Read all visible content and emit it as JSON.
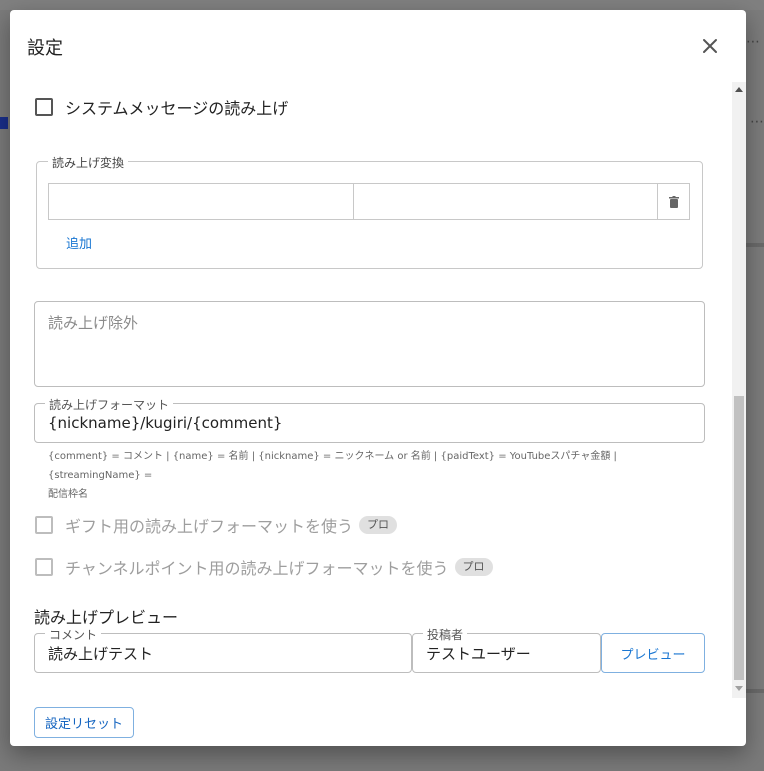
{
  "dialog": {
    "title": "設定"
  },
  "tts": {
    "system_message_label": "システムメッセージの読み上げ",
    "conversion": {
      "legend": "読み上げ変換",
      "from_value": "",
      "to_value": "",
      "add_label": "追加"
    },
    "exclude": {
      "placeholder": "読み上げ除外",
      "value": ""
    },
    "format": {
      "label": "読み上げフォーマット",
      "value": "{nickname}/kugiri/{comment}",
      "help_line1": "{comment} = コメント | {name} = 名前 | {nickname} = ニックネーム or 名前 | {paidText} = YouTubeスパチャ金額 | {streamingName} =",
      "help_line2": "配信枠名"
    },
    "gift_format_label": "ギフト用の読み上げフォーマットを使う",
    "gift_format_chip": "プロ",
    "channel_point_format_label": "チャンネルポイント用の読み上げフォーマットを使う",
    "channel_point_format_chip": "プロ",
    "preview": {
      "title": "読み上げプレビュー",
      "comment_label": "コメント",
      "comment_value": "読み上げテスト",
      "poster_label": "投稿者",
      "poster_value": "テストユーザー",
      "button_label": "プレビュー"
    }
  },
  "footer": {
    "reset_label": "設定リセット"
  },
  "colors": {
    "accent": "#1976d2",
    "overlay": "#7a7a7a"
  }
}
